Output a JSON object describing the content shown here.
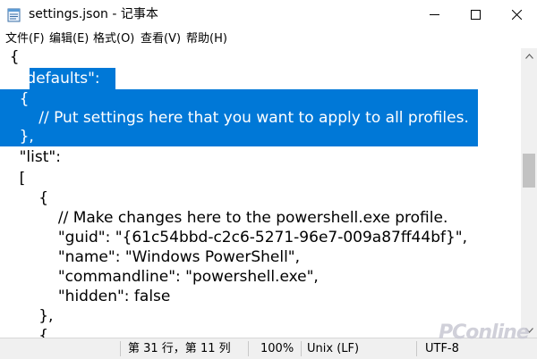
{
  "window": {
    "title": "settings.json - 记事本",
    "icon": "notepad-icon"
  },
  "menu": [
    "文件(F)",
    "编辑(E)",
    "格式(O)",
    "查看(V)",
    "帮助(H)"
  ],
  "editor": {
    "lines": [
      "  {",
      "    \"defaults\":",
      "    {",
      "        // Put settings here that you want to apply to all profiles.",
      "    },",
      "    \"list\":",
      "    [",
      "        {",
      "            // Make changes here to the powershell.exe profile.",
      "            \"guid\": \"{61c54bbd-c2c6-5271-96e7-009a87ff44bf}\",",
      "            \"name\": \"Windows PowerShell\",",
      "            \"commandline\": \"powershell.exe\",",
      "            \"hidden\": false",
      "        },",
      "        {"
    ],
    "selection_color": "#0078d7"
  },
  "status": {
    "position": "第 31 行，第 11 列",
    "zoom": "100%",
    "line_ending": "Unix (LF)",
    "encoding": "UTF-8"
  },
  "watermark": "PConline"
}
